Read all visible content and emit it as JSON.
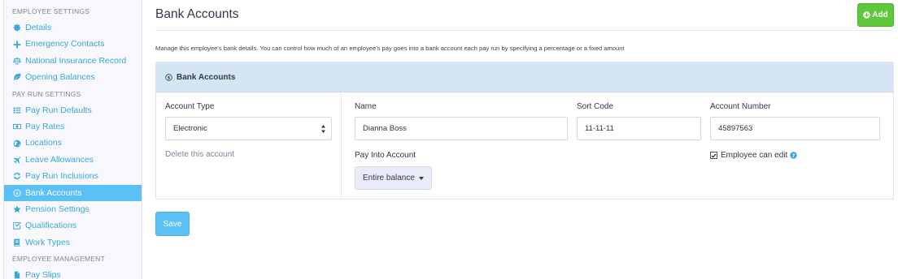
{
  "sidebar": {
    "sections": [
      {
        "title": "EMPLOYEE SETTINGS",
        "items": [
          {
            "label": "Details",
            "icon": "gear-icon"
          },
          {
            "label": "Emergency Contacts",
            "icon": "plus-icon"
          },
          {
            "label": "National Insurance Record",
            "icon": "balance-scale-icon"
          },
          {
            "label": "Opening Balances",
            "icon": "leaf-icon"
          }
        ]
      },
      {
        "title": "PAY RUN SETTINGS",
        "items": [
          {
            "label": "Pay Run Defaults",
            "icon": "list-icon"
          },
          {
            "label": "Pay Rates",
            "icon": "money-icon"
          },
          {
            "label": "Locations",
            "icon": "globe-icon"
          },
          {
            "label": "Leave Allowances",
            "icon": "plane-icon"
          },
          {
            "label": "Pay Run Inclusions",
            "icon": "refresh-icon"
          },
          {
            "label": "Bank Accounts",
            "icon": "dollar-circle-icon",
            "active": true
          },
          {
            "label": "Pension Settings",
            "icon": "star-icon"
          },
          {
            "label": "Qualifications",
            "icon": "check-square-icon"
          },
          {
            "label": "Work Types",
            "icon": "book-icon"
          }
        ]
      },
      {
        "title": "EMPLOYEE MANAGEMENT",
        "items": [
          {
            "label": "Pay Slips",
            "icon": "file-icon"
          }
        ]
      }
    ]
  },
  "header": {
    "title": "Bank Accounts",
    "add_label": "Add"
  },
  "description": "Manage this employee's bank details. You can control how much of an employee's pay goes into a bank account each pay run by specifying a percentage or a fixed amount",
  "panel": {
    "title": "Bank Accounts",
    "account_type_label": "Account Type",
    "account_type_value": "Electronic",
    "delete_label": "Delete this account",
    "name_label": "Name",
    "name_value": "Dianna Boss",
    "sort_code_label": "Sort Code",
    "sort_code_value": "11-11-11",
    "account_number_label": "Account Number",
    "account_number_value": "45897563",
    "pay_into_label": "Pay Into Account",
    "pay_into_value": "Entire balance",
    "employee_can_edit_label": "Employee can edit",
    "employee_can_edit_checked": true
  },
  "save_label": "Save",
  "colors": {
    "accent": "#5bc0f5",
    "link": "#3aa8d8",
    "add_button": "#5ec73a",
    "panel_header": "#d6e5f5"
  }
}
